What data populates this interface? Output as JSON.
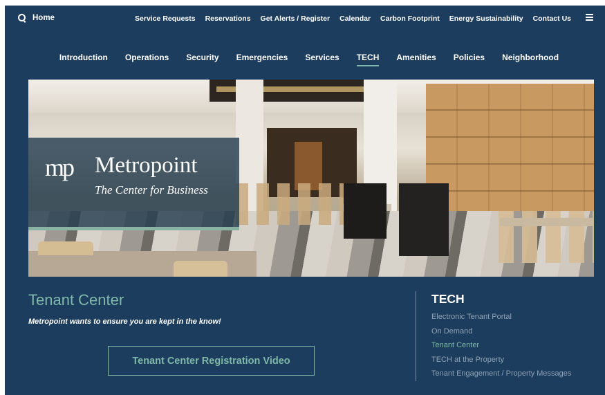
{
  "header": {
    "home_label": "Home",
    "utility_links": [
      "Service Requests",
      "Reservations",
      "Get Alerts / Register",
      "Calendar",
      "Carbon Footprint",
      "Energy Sustainability",
      "Contact Us"
    ],
    "menu_icon": "hamburger-menu-icon",
    "search_icon": "search-icon"
  },
  "main_nav": {
    "items": [
      "Introduction",
      "Operations",
      "Security",
      "Emergencies",
      "Services",
      "TECH",
      "Amenities",
      "Policies",
      "Neighborhood"
    ],
    "active": "TECH"
  },
  "hero": {
    "logo_mark": "mp",
    "logo_name": "Metropoint",
    "logo_tagline": "The Center for Business"
  },
  "content": {
    "title": "Tenant Center",
    "intro": "Metropoint wants to ensure you are kept in the know!",
    "video_button": "Tenant Center Registration Video"
  },
  "sidebar": {
    "title": "TECH",
    "items": [
      "Electronic Tenant Portal",
      "On Demand",
      "Tenant Center",
      "TECH at the Property",
      "Tenant Engagement / Property Messages"
    ],
    "current": "Tenant Center"
  },
  "colors": {
    "background": "#1d3d5e",
    "accent": "#7fb8a8",
    "muted_link": "#8ea2b4"
  }
}
